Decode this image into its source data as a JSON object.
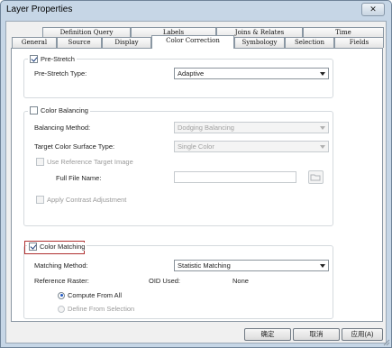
{
  "window": {
    "title": "Layer Properties",
    "close_glyph": "✕"
  },
  "tabs_row1": [
    "Definition Query",
    "Labels",
    "Joins & Relates",
    "Time"
  ],
  "tabs_row2": [
    "General",
    "Source",
    "Display",
    "Color Correction",
    "Symbology",
    "Selection",
    "Fields"
  ],
  "active_tab": "Color Correction",
  "prestretch": {
    "checkbox_label": "Pre-Stretch",
    "checked": true,
    "type_label": "Pre-Stretch Type:",
    "type_value": "Adaptive"
  },
  "color_balancing": {
    "checkbox_label": "Color Balancing",
    "checked": false,
    "method_label": "Balancing Method:",
    "method_value": "Dodging Balancing",
    "surface_label": "Target Color Surface Type:",
    "surface_value": "Single Color",
    "use_ref_label": "Use Reference Target Image",
    "full_file_label": "Full File Name:",
    "full_file_value": "",
    "contrast_label": "Apply Contrast Adjustment"
  },
  "color_matching": {
    "checkbox_label": "Color Matching",
    "checked": true,
    "method_label": "Matching Method:",
    "method_value": "Statistic Matching",
    "ref_raster_label": "Reference Raster:",
    "oid_label": "OID Used:",
    "oid_value": "None",
    "compute_all_label": "Compute From All",
    "define_sel_label": "Define From Selection",
    "compute_selected": true
  },
  "buttons": {
    "ok": "确定",
    "cancel": "取消",
    "apply": "应用(A)"
  },
  "colors": {
    "highlight_border": "#b03030",
    "window_frame": "#c6d6e6"
  }
}
